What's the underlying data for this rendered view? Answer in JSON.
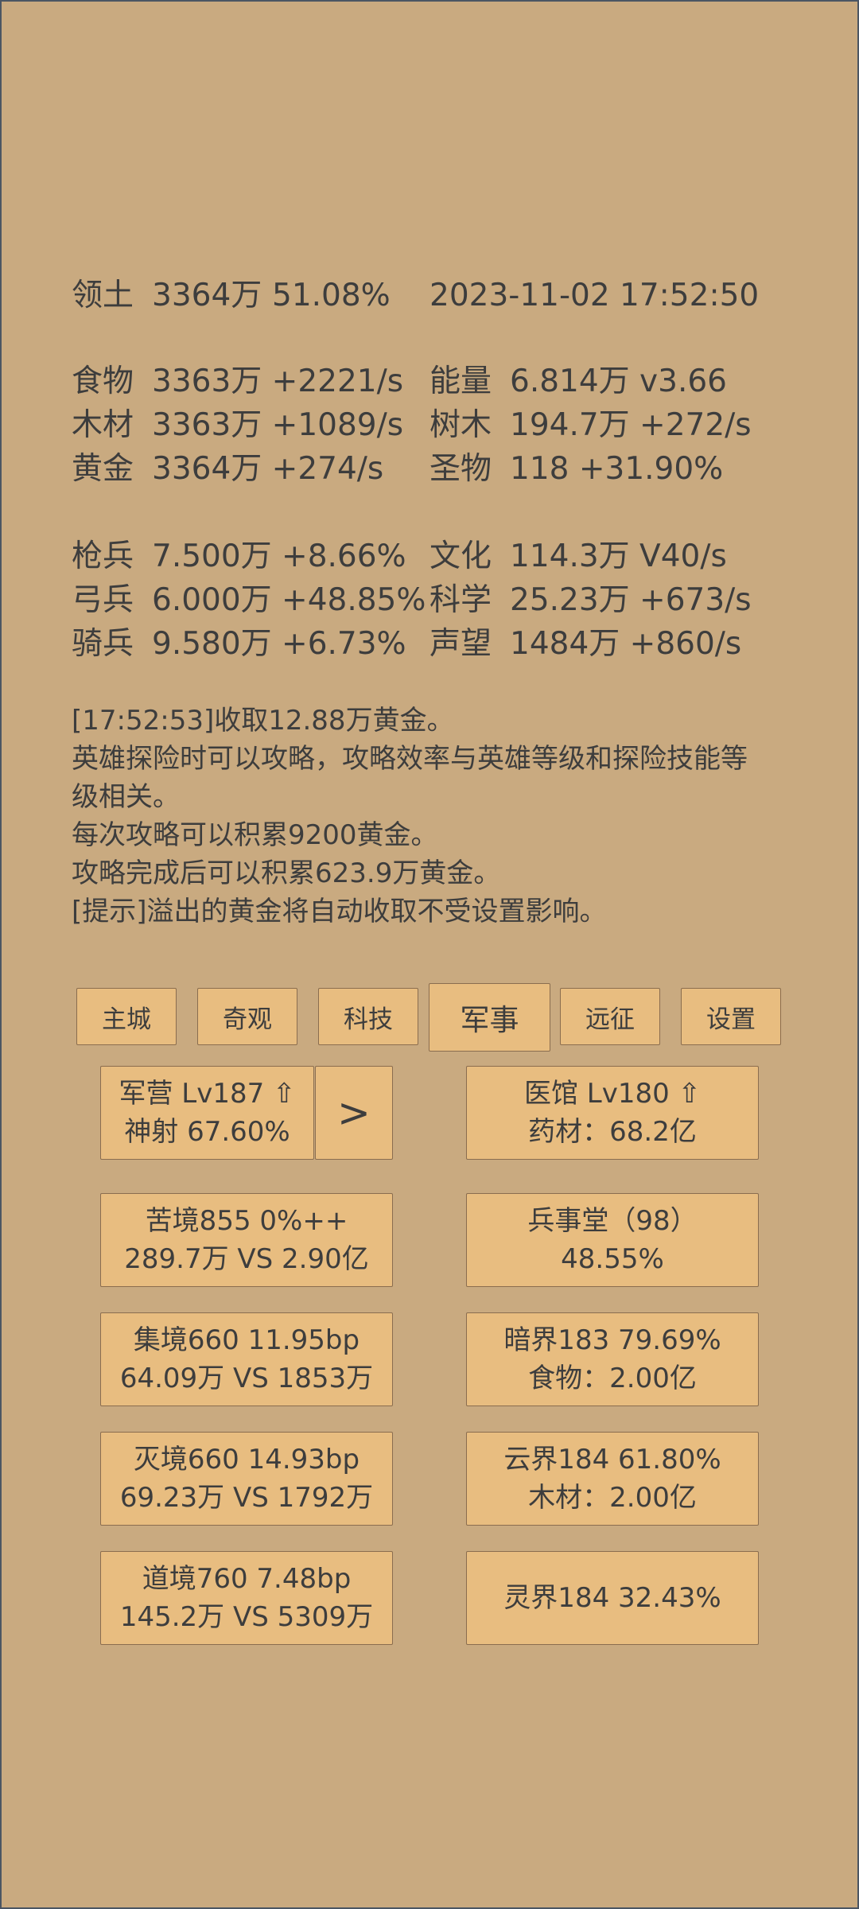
{
  "header": {
    "territory_label": "领土",
    "territory_value": "3364万",
    "territory_pct": "51.08%",
    "datetime": "2023-11-02 17:52:50"
  },
  "resources": [
    {
      "label": "食物",
      "value": "3363万 +2221/s",
      "label2": "能量",
      "value2": "6.814万  v3.66"
    },
    {
      "label": "木材",
      "value": "3363万 +1089/s",
      "label2": "树木",
      "value2": "194.7万 +272/s"
    },
    {
      "label": "黄金",
      "value": "3364万 +274/s",
      "label2": "圣物",
      "value2": "118 +31.90%"
    }
  ],
  "army": [
    {
      "label": "枪兵",
      "value": "7.500万 +8.66%",
      "label2": "文化",
      "value2": "114.3万 V40/s"
    },
    {
      "label": "弓兵",
      "value": "6.000万 +48.85%",
      "label2": "科学",
      "value2": "25.23万 +673/s"
    },
    {
      "label": "骑兵",
      "value": "9.580万 +6.73%",
      "label2": "声望",
      "value2": "1484万 +860/s"
    }
  ],
  "log": [
    "[17:52:53]收取12.88万黄金。",
    "英雄探险时可以攻略，攻略效率与英雄等级和探险技能等",
    "级相关。",
    "每次攻略可以积累9200黄金。",
    "攻略完成后可以积累623.9万黄金。",
    "[提示]溢出的黄金将自动收取不受设置影响。"
  ],
  "tabs": [
    "主城",
    "奇观",
    "科技",
    "军事",
    "远征",
    "设置"
  ],
  "active_tab": "军事",
  "cards": {
    "barracks": {
      "line1": "军营 Lv187 ⇧",
      "line2": "神射 67.60%"
    },
    "next": ">",
    "hospital": {
      "line1": "医馆 Lv180 ⇧",
      "line2": "药材：68.2亿"
    },
    "c1": {
      "line1": "苦境855  0%++",
      "line2": "289.7万 VS 2.90亿"
    },
    "c2": {
      "line1": "兵事堂（98）",
      "line2": "48.55%"
    },
    "c3": {
      "line1": "集境660  11.95bp",
      "line2": "64.09万 VS 1853万"
    },
    "c4": {
      "line1": "暗界183  79.69%",
      "line2": "食物：2.00亿"
    },
    "c5": {
      "line1": "灭境660  14.93bp",
      "line2": "69.23万 VS 1792万"
    },
    "c6": {
      "line1": "云界184  61.80%",
      "line2": "木材：2.00亿"
    },
    "c7": {
      "line1": "道境760  7.48bp",
      "line2": "145.2万 VS 5309万"
    },
    "c8": {
      "line1": "灵界184  32.43%"
    }
  }
}
